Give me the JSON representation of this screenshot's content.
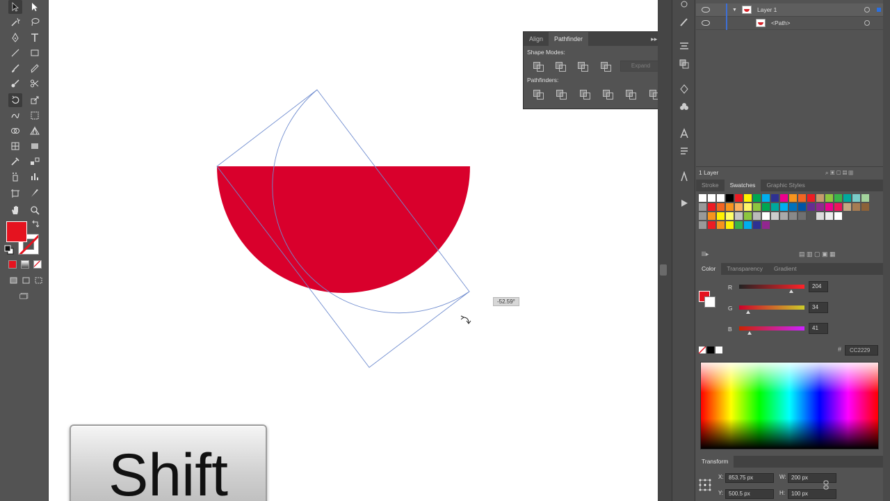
{
  "canvas": {
    "angle_readout": "-52.59°",
    "shape_fill": "#d9002c",
    "guide_color": "#6f8ccf"
  },
  "overlay": {
    "key_label": "Shift"
  },
  "toolbar": {
    "fill_color": "#e5131f",
    "stroke_color": "#e5131f"
  },
  "pathfinder_panel": {
    "tabs": [
      "Align",
      "Pathfinder"
    ],
    "active_tab": "Pathfinder",
    "shape_modes_label": "Shape Modes:",
    "pathfinders_label": "Pathfinders:",
    "expand_label": "Expand"
  },
  "layers": {
    "rows": [
      {
        "name": "Layer 1"
      },
      {
        "name": "<Path>"
      }
    ],
    "footer": "1 Layer"
  },
  "swatches_panel": {
    "tabs": [
      "Stroke",
      "Swatches",
      "Graphic Styles"
    ],
    "active_tab": "Swatches"
  },
  "color_panel": {
    "tabs": [
      "Color",
      "Transparency",
      "Gradient"
    ],
    "active_tab": "Color",
    "channels": [
      {
        "label": "R",
        "value": "204"
      },
      {
        "label": "G",
        "value": "34"
      },
      {
        "label": "B",
        "value": "41"
      }
    ],
    "hex": "CC2229"
  },
  "transform_panel": {
    "title": "Transform",
    "x": "853.75 px",
    "y": "500.5 px",
    "w": "200 px",
    "h": "100 px",
    "x_label": "X:",
    "y_label": "Y:",
    "w_label": "W:",
    "h_label": "H:"
  }
}
